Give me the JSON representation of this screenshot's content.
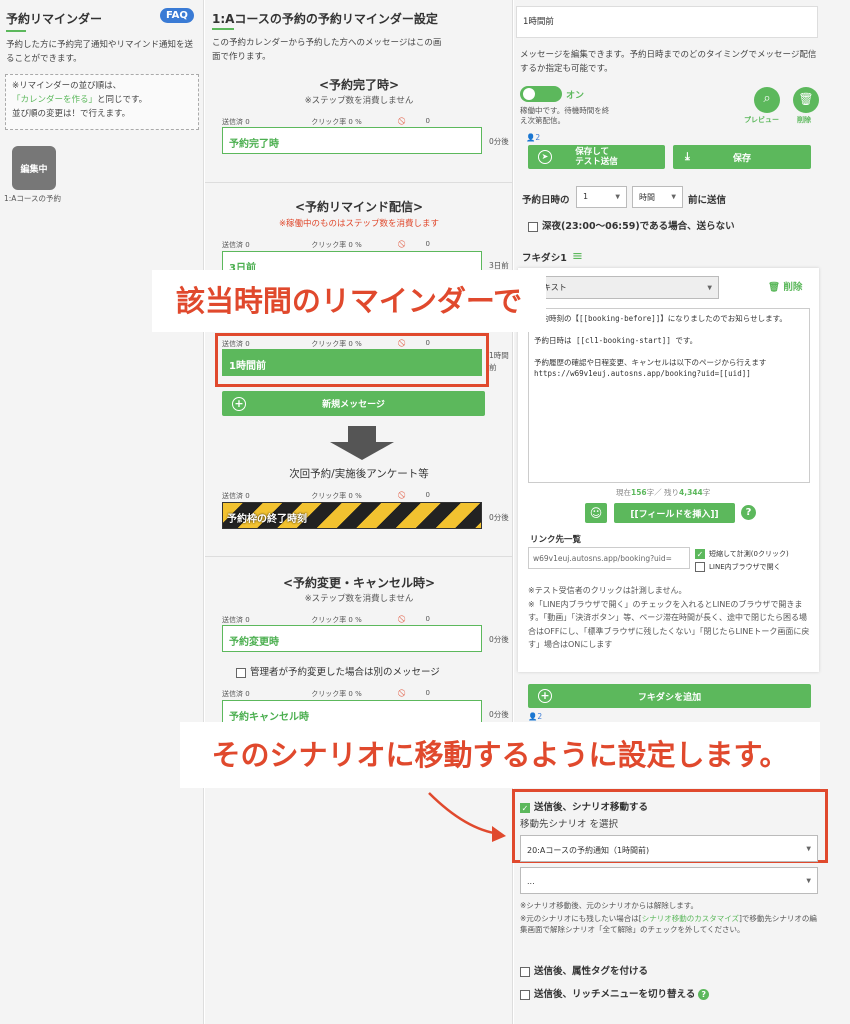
{
  "sidebar": {
    "title": "予約リマインダー",
    "faq": "FAQ",
    "desc": "予約した方に予約完了通知やリマインド通知を送ることができます。",
    "note_line1": "※リマインダーの並び順は、",
    "note_link": "「カレンダーを作る」",
    "note_line2": "と同じです。",
    "note_line3": "並び順の変更は！で行えます。",
    "item_badge": "編集中",
    "item_label": "1:Aコースの予約"
  },
  "middle": {
    "title": "1:Aコースの予約の予約リマインダー設定",
    "desc": "この予約カレンダーから予約した方へのメッセージはこの画面で作ります。",
    "stat_sent": "送信済 0",
    "stat_click": "クリック率 0 %",
    "stat_block": "0",
    "section_complete": "<予約完了時>",
    "section_complete_sub": "※ステップ数を消費しません",
    "step_complete": "予約完了時",
    "ago_zero": "0分後",
    "section_remind": "<予約リマインド配信>",
    "section_remind_sub": "※稼働中のものはステップ数を消費します",
    "step_3days": "3日前",
    "ago_3days": "3日前",
    "step_1hour": "1時間前",
    "ago_1hour": "1時間前",
    "new_message": "新規メッセージ",
    "next_label": "次回予約/実施後アンケート等",
    "step_end": "予約枠の終了時刻",
    "section_change": "<予約変更・キャンセル時>",
    "section_change_sub": "※ステップ数を消費しません",
    "step_change": "予約変更時",
    "admin_change": "管理者が予約変更した場合は別のメッセージ",
    "step_cancel": "予約キャンセル時"
  },
  "right": {
    "name_value": "1時間前",
    "desc": "メッセージを編集できます。予約日時までのどのタイミングでメッセージ配信するか指定も可能です。",
    "toggle": "オン",
    "running_note": "稼働中です。待機時間を終え次第配信。",
    "preview": "プレビュー",
    "delete": "削除",
    "count_2": "2",
    "save_test": "保存して\nテスト送信",
    "save": "保存",
    "timing_label": "予約日時の",
    "timing_num": "1",
    "timing_unit": "時間",
    "timing_suffix": "前に送信",
    "night_label": "深夜(23:00〜06:59)である場合、送らない",
    "fukidashi": "フキダシ1",
    "text_type": "テキスト",
    "fuki_delete": "削除",
    "message_body": "予約時刻の【[[booking-before]]】になりましたのでお知らせします。\n\n予約日時は [[cl1-booking-start]] です。\n\n予約履歴の確認や日程変更、キャンセルは以下のページから行えます\nhttps://w69v1euj.autosns.app/booking?uid=[[uid]]",
    "char_count_prefix": "現在",
    "char_count": "156",
    "char_count_mid": "字／ 残り",
    "char_left": "4,344",
    "char_suffix": "字",
    "insert_field": "[[フィールドを挿入]]",
    "link_title": "リンク先一覧",
    "link_value": "w69v1euj.autosns.app/booking?uid=",
    "shorten": "短縮して計測(0クリック)",
    "line_browser": "LINE内ブラウザで開く",
    "link_note": "※テスト受信者のクリックは計測しません。\n※「LINE内ブラウザで開く」のチェックを入れるとLINEのブラウザで開きます。「動画」「決済ボタン」等、ページ滞在時間が長く、途中で閉じたら困る場合はOFFにし、「標準ブラウザに残したくない」「閉じたらLINEトーク画面に戻す」場合はONにします",
    "add_fukidashi": "フキダシを追加",
    "count_2b": "2",
    "after_scenario": "送信後、シナリオ移動する",
    "dest_label": "移動先シナリオ を選択",
    "dest_value": "20:Aコースの予約通知（1時間前)",
    "dest_value2": "...",
    "scenario_note1": "※シナリオ移動後、元のシナリオからは解除します。",
    "scenario_note2a": "※元のシナリオにも残したい場合は[",
    "scenario_note2_link": "シナリオ移動のカスタマイズ",
    "scenario_note2b": "]で移動先シナリオの編集画面で解除シナリオ「全て解除」のチェックを外してください。",
    "after_tag": "送信後、属性タグを付ける",
    "after_menu": "送信後、リッチメニューを切り替える"
  },
  "overlays": {
    "text1": "該当時間のリマインダーで",
    "text2": "そのシナリオに移動するように設定します。"
  },
  "colors": {
    "green": "#5cb85c",
    "red_annotation": "#e0492d",
    "faq_blue": "#3a7bd5"
  }
}
